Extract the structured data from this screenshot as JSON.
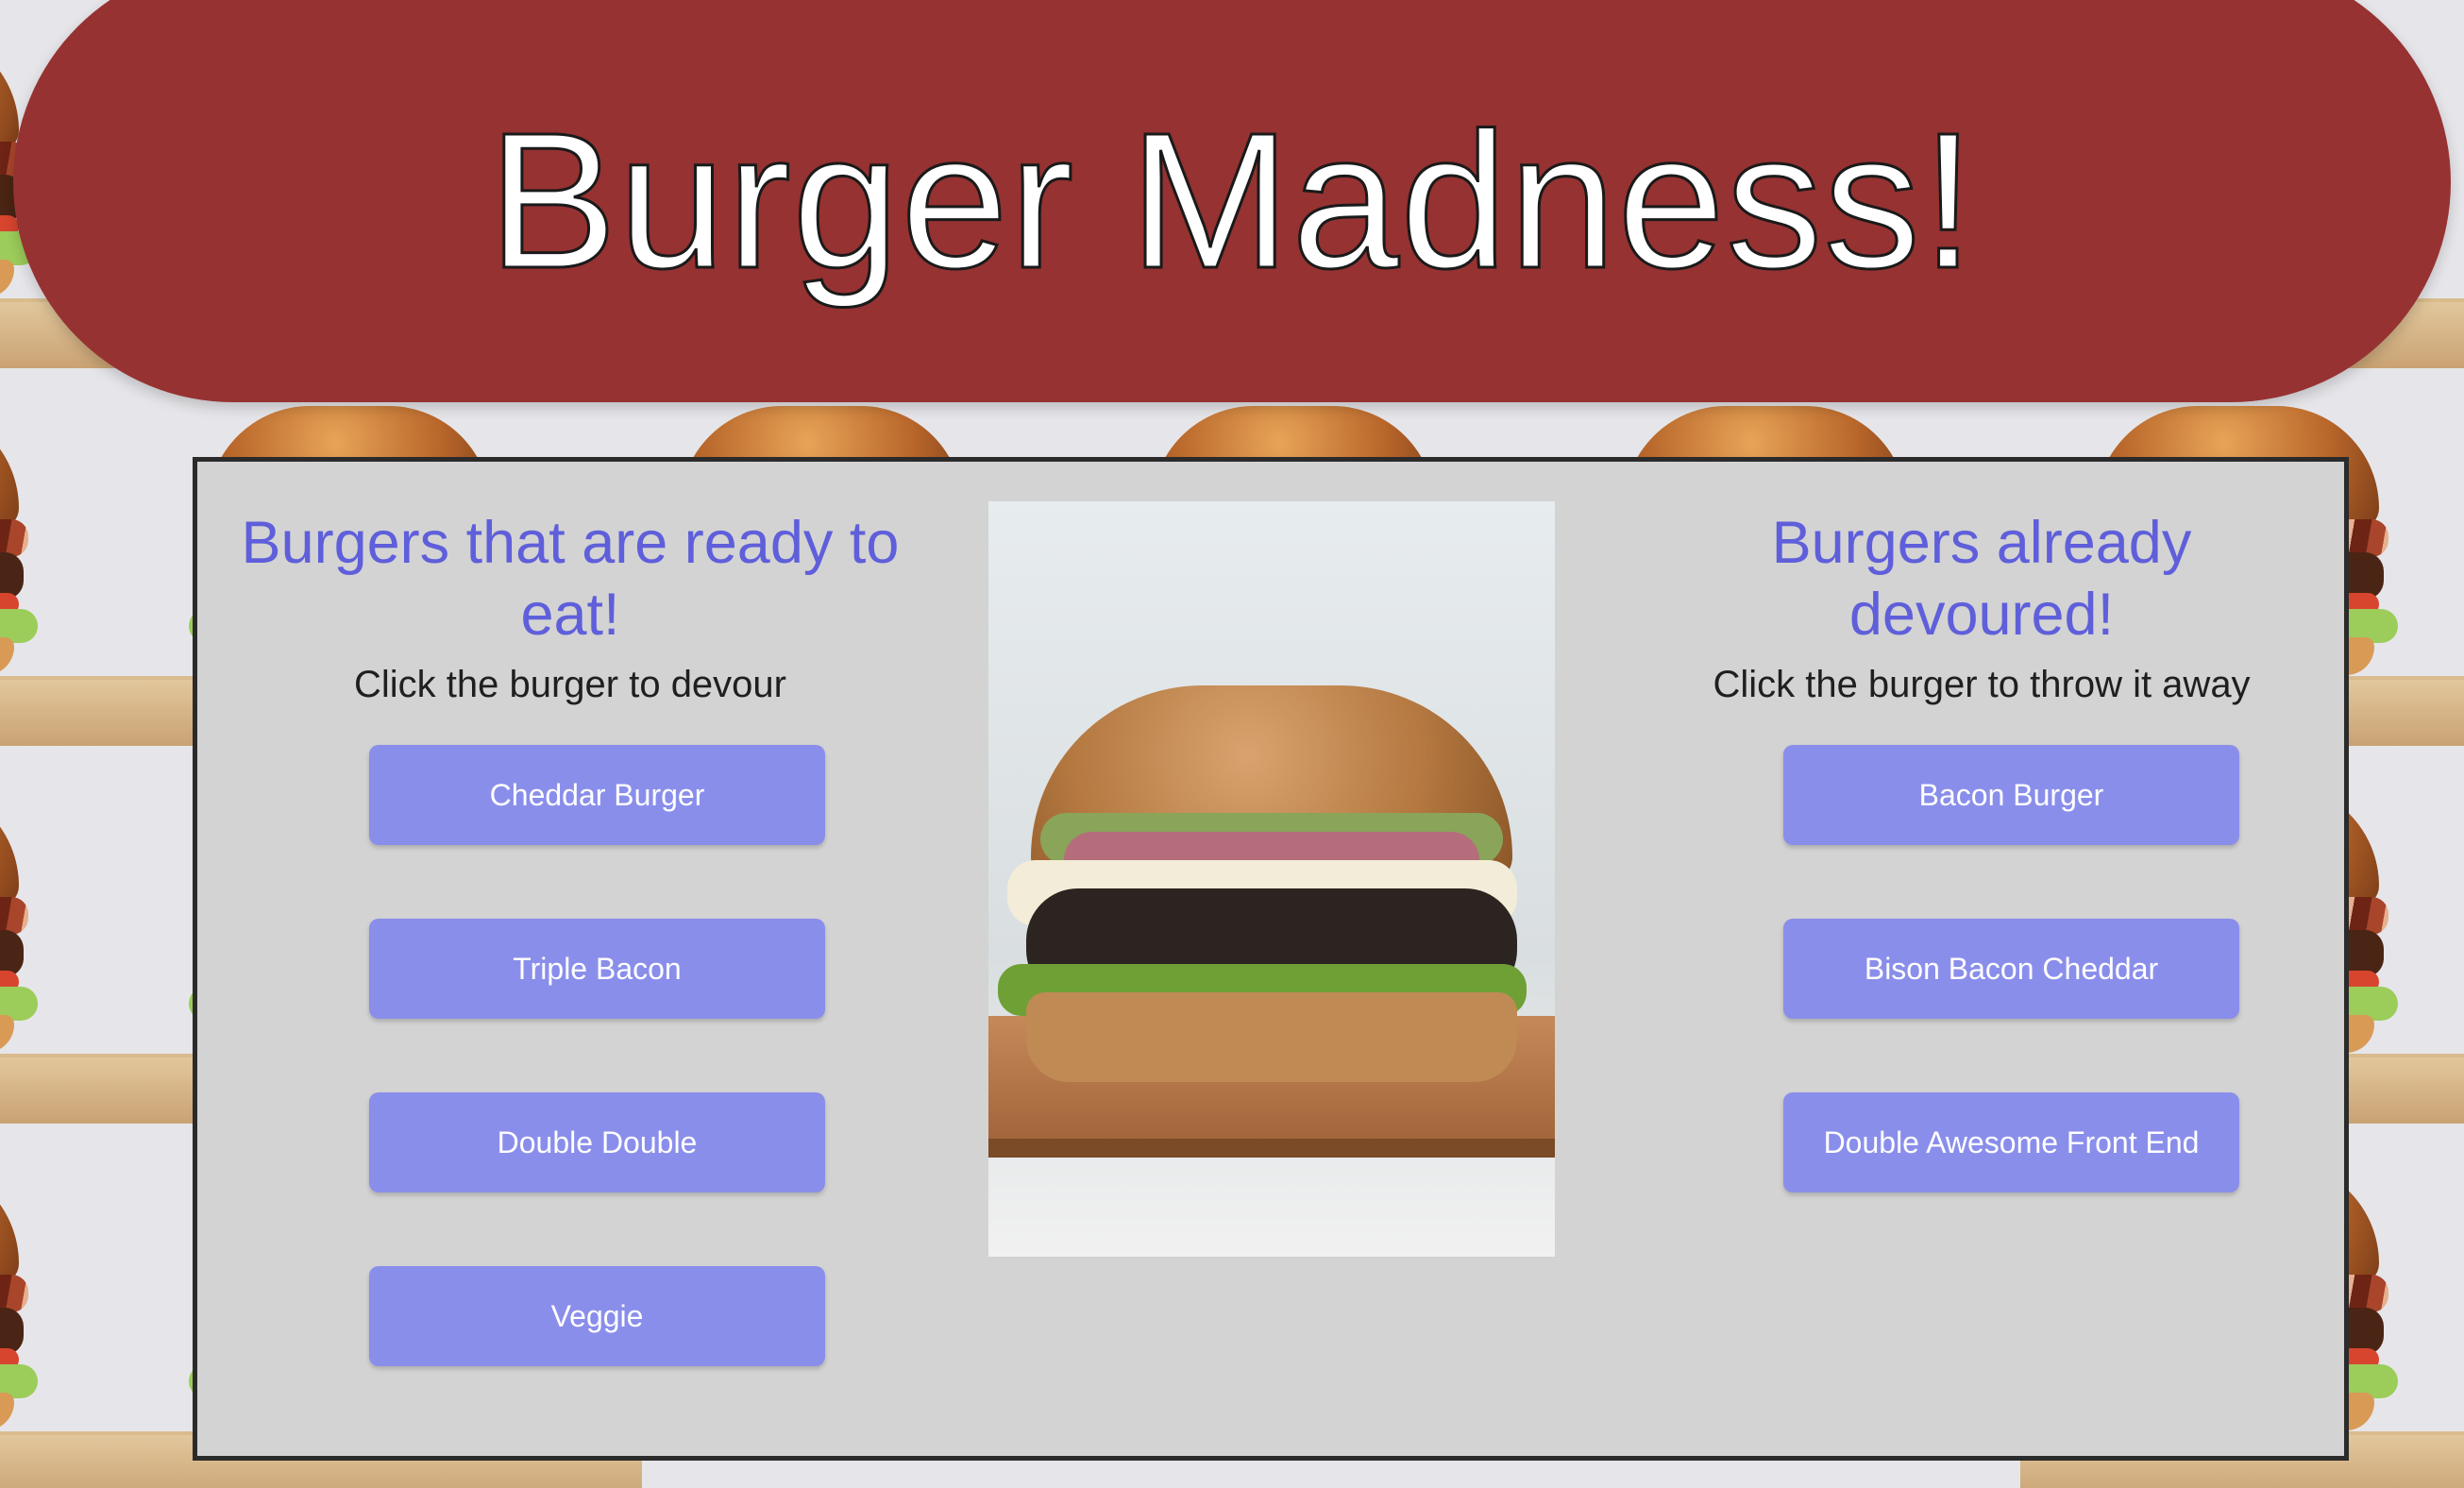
{
  "header": {
    "title": "Burger Madness!"
  },
  "ready": {
    "heading": "Burgers that are ready to eat!",
    "instruction": "Click the burger to devour",
    "burgers": [
      "Cheddar Burger",
      "Triple Bacon",
      "Double Double",
      "Veggie"
    ]
  },
  "devoured": {
    "heading": "Burgers already devoured!",
    "instruction": "Click the burger to throw it away",
    "burgers": [
      "Bacon Burger",
      "Bison Bacon Cheddar",
      "Double Awesome Front End"
    ]
  },
  "colors": {
    "header_bg": "#963232",
    "heading_text": "#5f5fdb",
    "button_bg": "#8a8eeb",
    "panel_bg": "#d3d3d3"
  }
}
